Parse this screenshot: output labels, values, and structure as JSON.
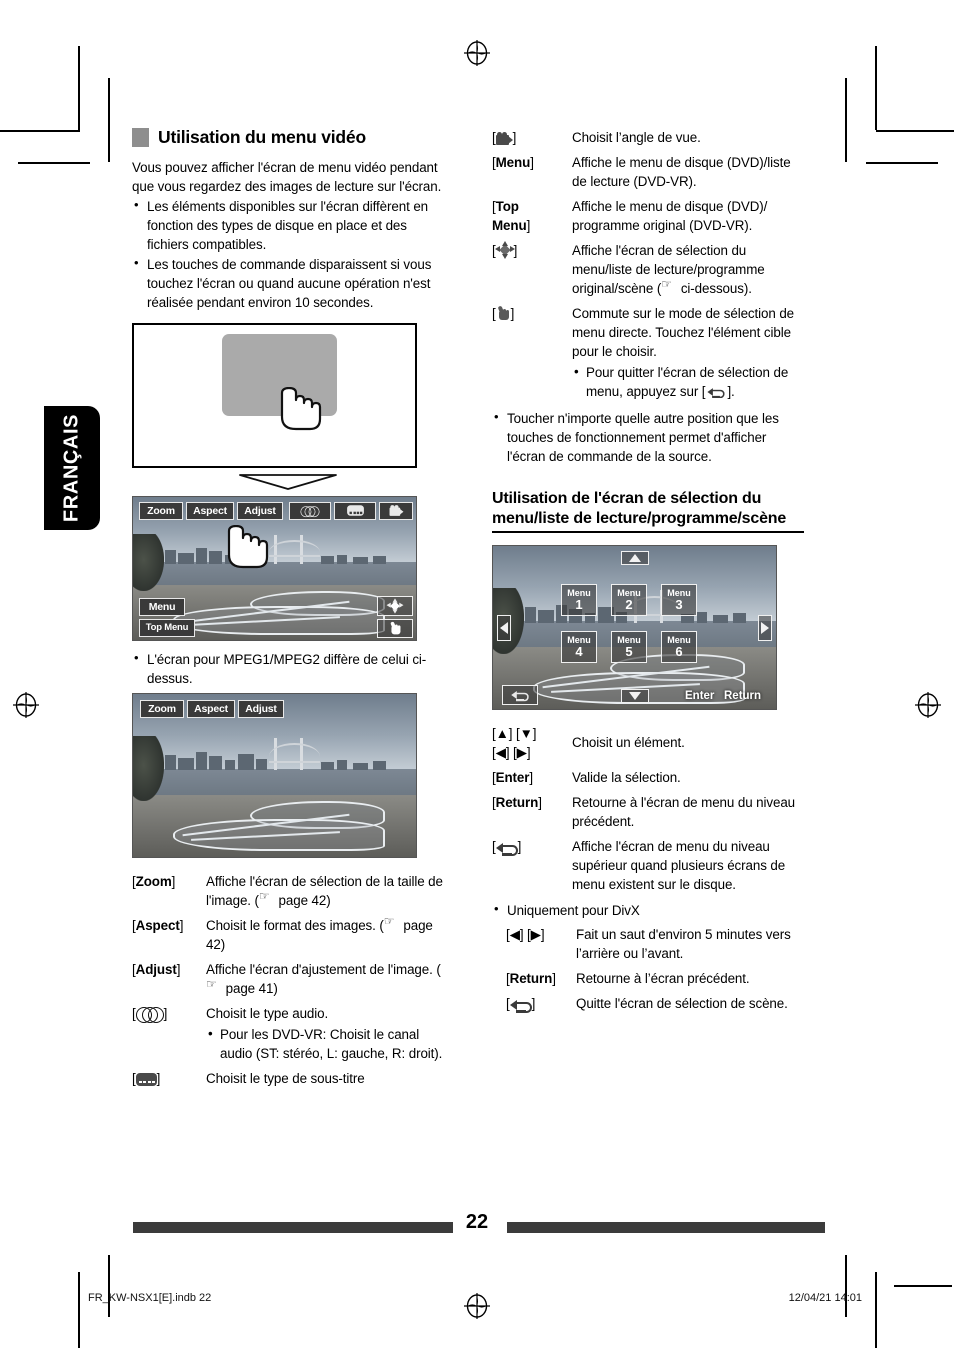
{
  "language_tab": {
    "label": "FRANÇAIS"
  },
  "left_column": {
    "heading": "Utilisation du menu vidéo",
    "intro": "Vous pouvez afficher l'écran de menu vidéo pendant que vous regardez des images de lecture sur l'écran.",
    "bullets": [
      "Les éléments disponibles sur l'écran diffèrent en fonction des types de disque en place et des fichiers compatibles.",
      "Les touches de commande disparaissent si vous touchez l'écran ou quand aucune opération n'est réalisée pendant environ 10 secondes."
    ],
    "screenshot1": {
      "top_buttons": [
        "Zoom",
        "Aspect",
        "Adjust"
      ],
      "top_icons": [
        "audio-icon",
        "subtitle-icon",
        "angle-camera-icon"
      ],
      "bottom_left_buttons": [
        "Menu",
        "Top Menu"
      ],
      "bottom_right_icons": [
        "dpad-icon",
        "hand-touch-icon"
      ],
      "hand_cursor": "hand-pointer-icon"
    },
    "mpeg_note": "L'écran pour MPEG1/MPEG2 diffère de celui ci-dessus.",
    "screenshot2": {
      "top_buttons": [
        "Zoom",
        "Aspect",
        "Adjust"
      ]
    },
    "definitions": [
      {
        "key": "Zoom",
        "key_bold": true,
        "desc": "Affiche l'écran de sélection de la taille de l'image. (☞ page 42)"
      },
      {
        "key": "Aspect",
        "key_bold": true,
        "desc": "Choisit le format des images. (☞ page 42)"
      },
      {
        "key": "Adjust",
        "key_bold": true,
        "desc": "Affiche l'écran d'ajustement de l'image. (☞ page 41)"
      },
      {
        "key": "audio-icon",
        "key_bold": false,
        "desc": "Choisit le type audio.",
        "sub": [
          "Pour les DVD-VR: Choisit le canal audio (ST: stéréo, L: gauche, R: droit)."
        ]
      },
      {
        "key": "subtitle-icon",
        "key_bold": false,
        "desc": "Choisit le type de sous-titre"
      }
    ]
  },
  "right_column": {
    "definitions_top": [
      {
        "key": "angle-camera-icon",
        "desc": "Choisit l’angle de vue."
      },
      {
        "key": "Menu",
        "desc": "Affiche le menu de disque (DVD)/liste de lecture (DVD-VR)."
      },
      {
        "key": "Top Menu",
        "desc": "Affiche le menu de disque (DVD)/ programme original (DVD-VR)."
      },
      {
        "key": "dpad-icon",
        "desc": "Affiche l'écran de sélection du menu/liste de lecture/programme original/scène (☞ ci-dessous)."
      },
      {
        "key": "hand-touch-icon",
        "desc": "Commute sur le mode de sélection de menu directe. Touchez l'élément cible pour le choisir.",
        "sub": [
          "Pour quitter l'écran de sélection de menu, appuyez sur [↩]."
        ]
      }
    ],
    "note_bullet": "Toucher n'importe quelle autre position que les touches de fonctionnement permet d'afficher l'écran de commande de la source.",
    "section_heading": "Utilisation de l'écran de sélection du menu/liste de lecture/programme/scène",
    "screenshot3": {
      "menu_buttons": [
        {
          "label": "Menu",
          "number": "1"
        },
        {
          "label": "Menu",
          "number": "2"
        },
        {
          "label": "Menu",
          "number": "3"
        },
        {
          "label": "Menu",
          "number": "4"
        },
        {
          "label": "Menu",
          "number": "5"
        },
        {
          "label": "Menu",
          "number": "6"
        }
      ],
      "nav_icons": [
        "arrow-up-icon",
        "arrow-down-icon",
        "arrow-left-icon",
        "arrow-right-icon",
        "back-return-icon"
      ],
      "text_buttons": [
        "Enter",
        "Return"
      ]
    },
    "definitions_bottom": [
      {
        "key": "arrow-keys",
        "key_line1": "[▲] [▼]",
        "key_line2": "[◀] [▶]",
        "desc": "Choisit un élément."
      },
      {
        "key": "Enter",
        "key_bold": true,
        "desc": "Valide la sélection."
      },
      {
        "key": "Return",
        "key_bold": true,
        "desc": "Retourne à l'écran de menu du niveau précédent."
      },
      {
        "key": "back-return-icon",
        "key_bold": false,
        "desc": "Affiche l'écran de menu du niveau supérieur quand plusieurs écrans de menu existent sur le disque."
      }
    ],
    "divx_bullet": "Uniquement pour DivX",
    "definitions_divx": [
      {
        "key": "[◀] [▶]",
        "desc": "Fait un saut d'environ 5 minutes vers l’arrière ou l’avant."
      },
      {
        "key": "Return",
        "key_bold": true,
        "desc": "Retourne à l’écran précédent."
      },
      {
        "key": "back-return-icon",
        "key_bold": false,
        "desc": "Quitte l'écran de sélection de scène."
      }
    ]
  },
  "footer": {
    "page_number": "22",
    "file_name": "FR_KW-NSX1[E].indb   22",
    "timestamp": "12/04/21   14:01"
  }
}
